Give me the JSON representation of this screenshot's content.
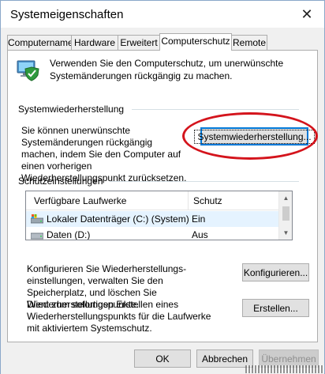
{
  "window": {
    "title": "Systemeigenschaften",
    "close_glyph": "✕"
  },
  "tabs": [
    {
      "label": "Computername"
    },
    {
      "label": "Hardware"
    },
    {
      "label": "Erweitert"
    },
    {
      "label": "Computerschutz",
      "active": true
    },
    {
      "label": "Remote"
    }
  ],
  "intro": {
    "icon": "system-protection-shield-icon",
    "text": "Verwenden Sie den Computerschutz, um unerwünschte Systemänderungen rückgängig zu machen."
  },
  "restore": {
    "group_label": "Systemwiederherstellung",
    "description": "Sie können unerwünschte Systemänderungen rückgängig machen, indem Sie den Computer auf einen vorherigen Wiederherstellungspunkt zurücksetzen.",
    "button_label": "Systemwiederherstellung...",
    "highlight_color": "#d4141c"
  },
  "protection": {
    "group_label": "Schutzeinstellungen",
    "columns": [
      "Verfügbare Laufwerke",
      "Schutz"
    ],
    "rows": [
      {
        "drive": "Lokaler Datenträger (C:) (System)",
        "status": "Ein",
        "icon": "system-drive-icon",
        "selected": true
      },
      {
        "drive": "Daten (D:)",
        "status": "Aus",
        "icon": "drive-icon"
      }
    ],
    "configure_text": "Konfigurieren Sie Wiederherstellungs-einstellungen, verwalten Sie den Speicherplatz, und löschen Sie Wiederherstellungspunkte.",
    "configure_button": "Konfigurieren...",
    "create_text": "Dient zum sofortigen Erstellen eines Wiederherstellungspunkts für die Laufwerke mit aktiviertem Systemschutz.",
    "create_button": "Erstellen..."
  },
  "footer": {
    "ok": "OK",
    "cancel": "Abbrechen",
    "apply": "Übernehmen"
  }
}
